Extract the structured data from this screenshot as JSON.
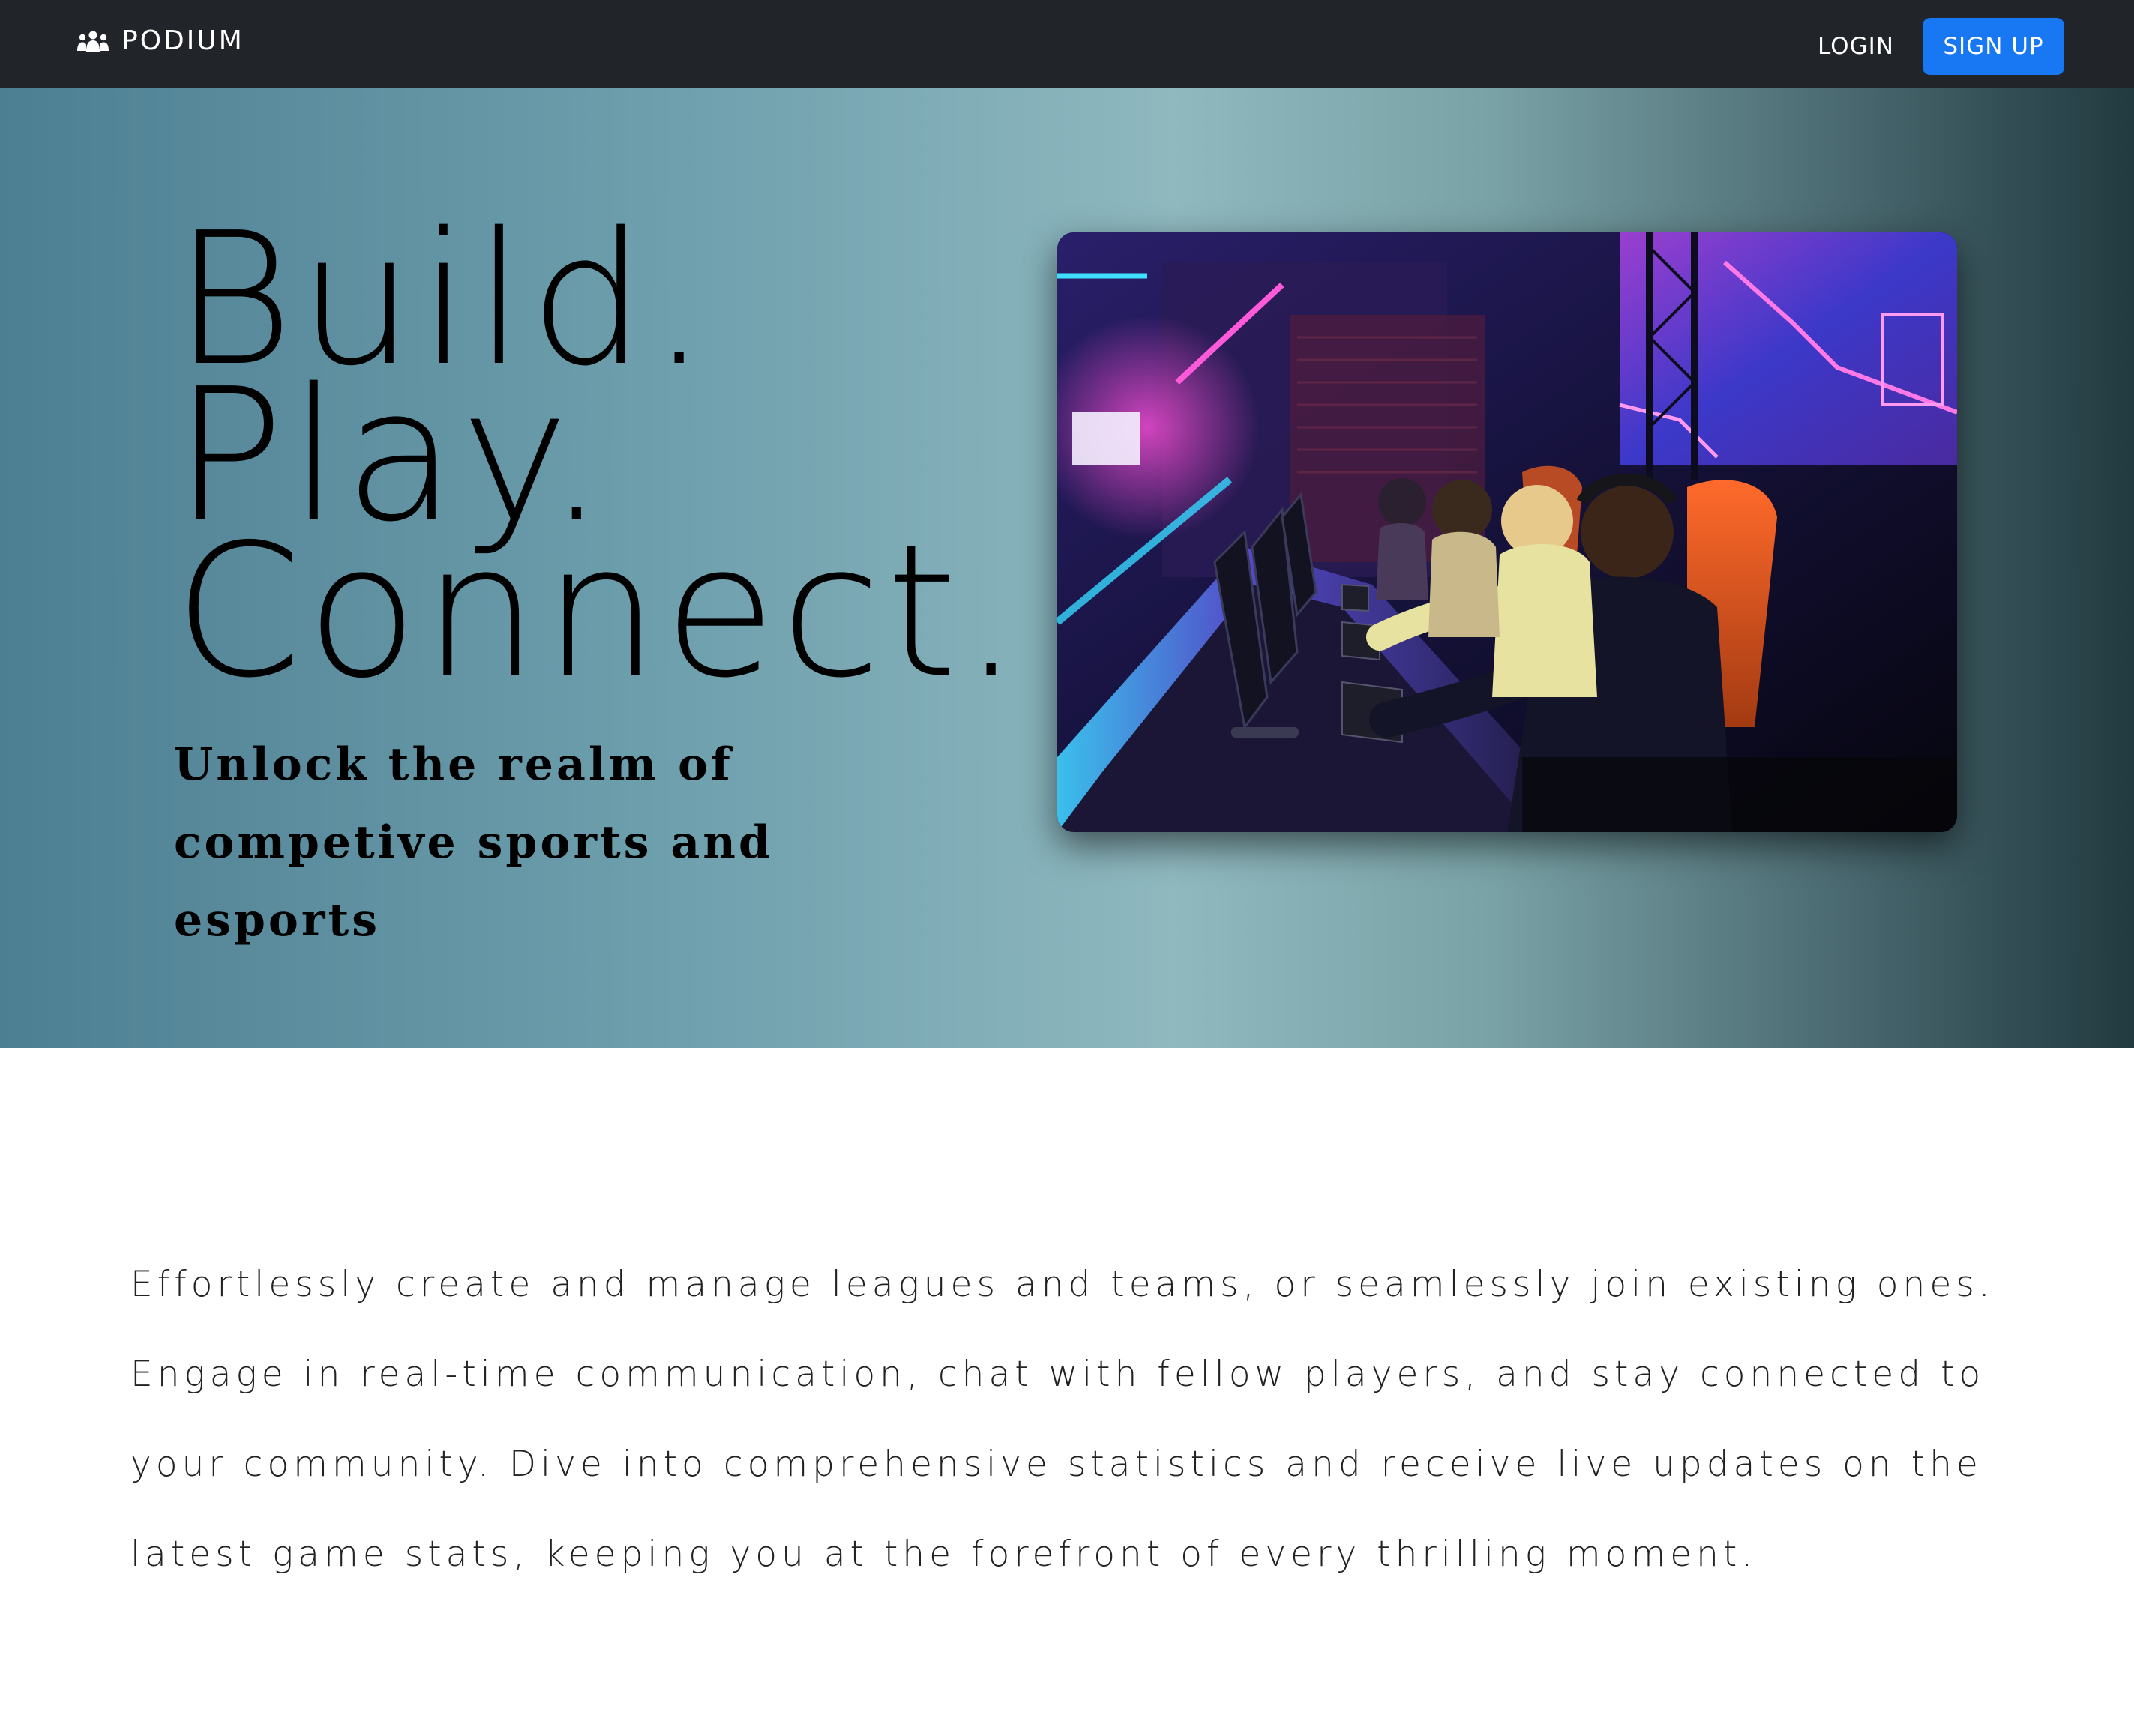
{
  "navbar": {
    "brand_icon": "people-group-icon",
    "brand_name": "PODIUM",
    "login_label": "LOGIN",
    "signup_label": "SIGN UP",
    "background_color": "#212429",
    "accent_color": "#1877f2"
  },
  "hero": {
    "headline_lines": [
      "Build.",
      "Play.",
      "Connect."
    ],
    "tagline": "Unlock the realm of competive sports and esports",
    "image_subject": "esports players at gaming stations in a neon-lit arena",
    "gradient_colors": [
      "#4d7f93",
      "#8fb8bf",
      "#213a40"
    ]
  },
  "about": {
    "description": "Effortlessly create and manage leagues and teams, or seamlessly join existing ones. Engage in real-time communication, chat with fellow players, and stay connected to your community. Dive into comprehensive statistics and receive live updates on the latest game stats, keeping you at the forefront of every thrilling moment."
  }
}
